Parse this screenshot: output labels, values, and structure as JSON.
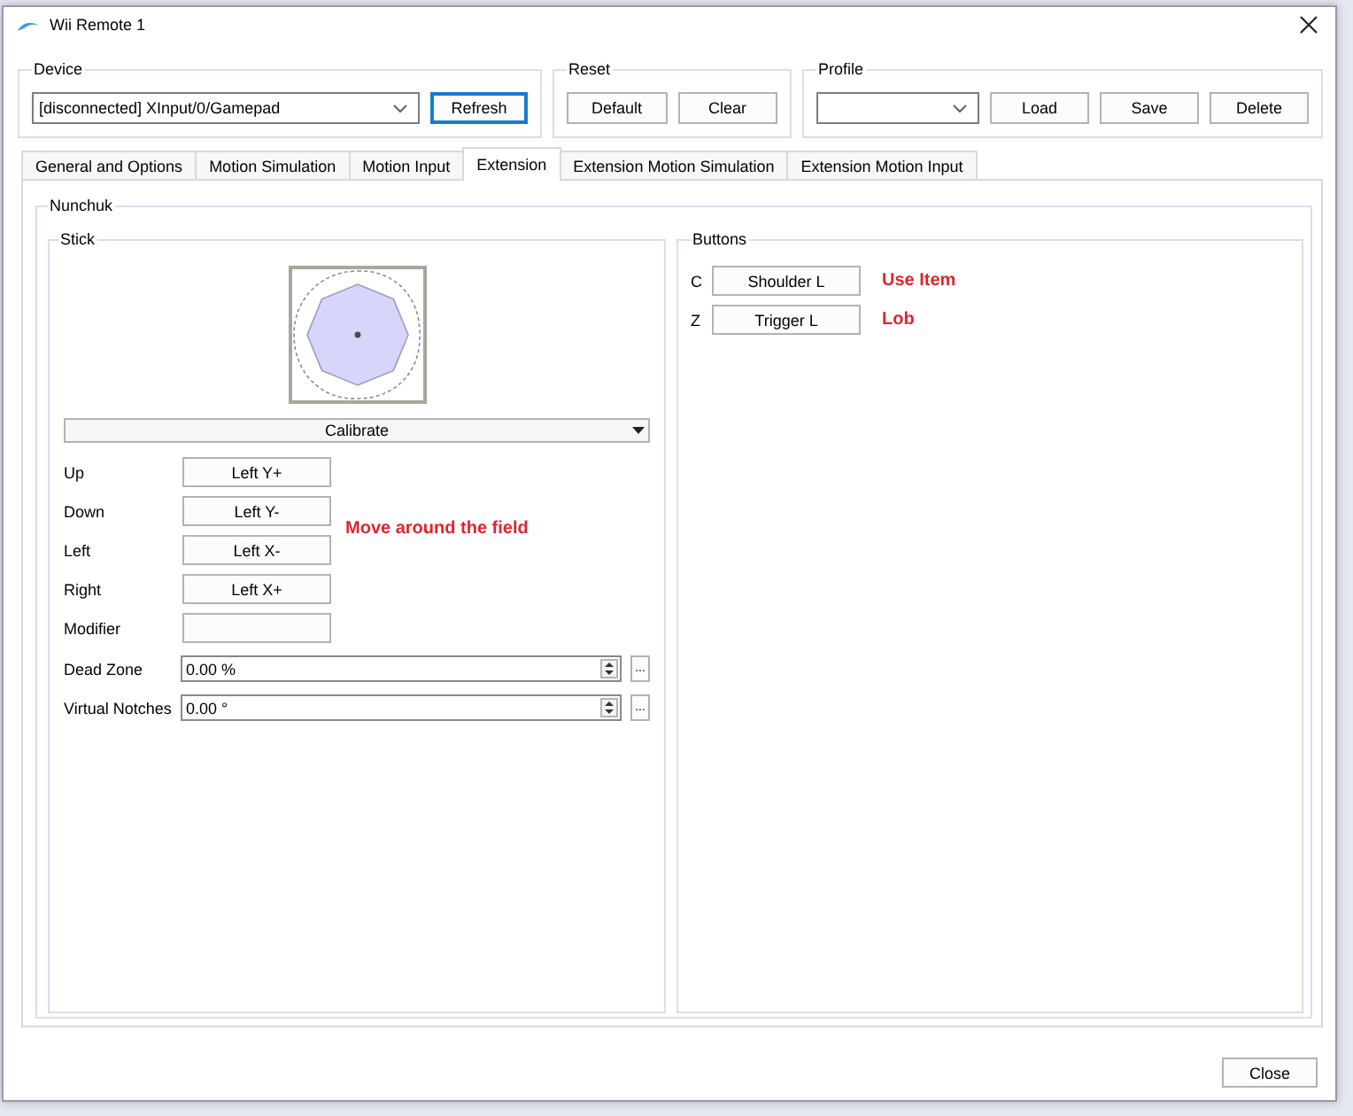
{
  "window": {
    "title": "Wii Remote 1"
  },
  "device": {
    "label": "Device",
    "selection": "[disconnected] XInput/0/Gamepad",
    "button": {
      "label": "Refresh",
      "focused": true
    }
  },
  "reset": {
    "label": "Reset",
    "buttons": [
      "Default",
      "Clear"
    ]
  },
  "profile": {
    "label": "Profile",
    "buttons": [
      "Load",
      "Save",
      "Delete"
    ]
  },
  "tabs": [
    {
      "label": "General and Options",
      "selected": false
    },
    {
      "label": "Motion Simulation",
      "selected": false
    },
    {
      "label": "Motion Input",
      "selected": false
    },
    {
      "label": "Extension",
      "selected": true
    },
    {
      "label": "Extension Motion Simulation",
      "selected": false
    },
    {
      "label": "Extension Motion Input",
      "selected": false
    }
  ],
  "extension": {
    "label": "Nunchuk",
    "stick": {
      "label": "Stick",
      "calibrate": "Calibrate",
      "note": "Move around the field",
      "mappings": [
        {
          "label": "Up",
          "binding": "Left Y+"
        },
        {
          "label": "Down",
          "binding": "Left Y-"
        },
        {
          "label": "Left",
          "binding": "Left X-"
        },
        {
          "label": "Right",
          "binding": "Left X+"
        },
        {
          "label": "Modifier"
        }
      ],
      "settings": [
        {
          "label": "Dead Zone",
          "value": "0.00 %",
          "more": "..."
        },
        {
          "label": "Virtual Notches",
          "value": "0.00 °",
          "more": "..."
        }
      ]
    },
    "buttons": {
      "label": "Buttons",
      "mappings": [
        {
          "key": "C",
          "binding": "Shoulder L",
          "note": "Use Item"
        },
        {
          "key": "Z",
          "binding": "Trigger L",
          "note": "Lob"
        }
      ]
    }
  },
  "footer": {
    "button": "Close"
  }
}
